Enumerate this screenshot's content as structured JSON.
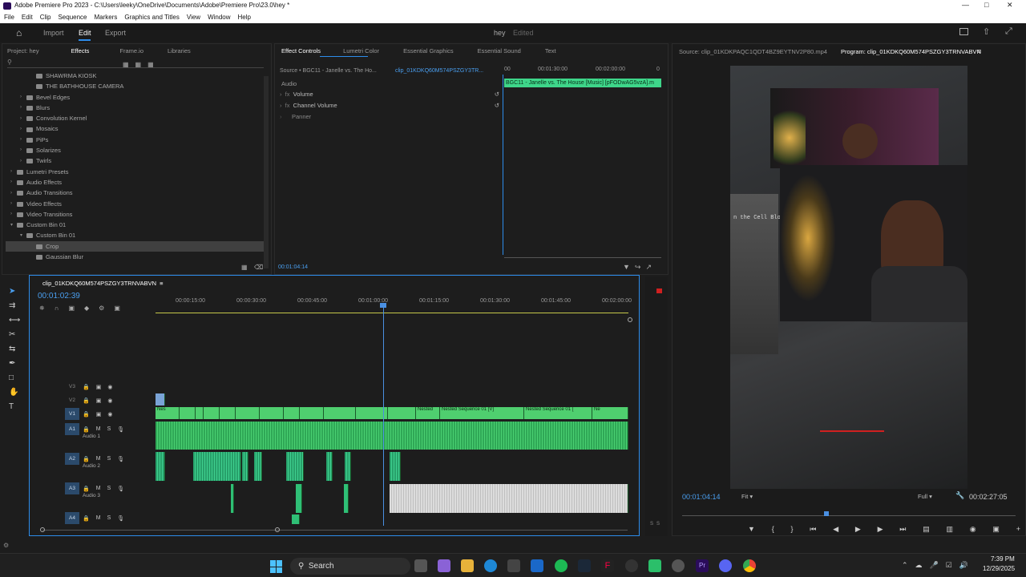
{
  "title": "Adobe Premiere Pro 2023 - C:\\Users\\leeky\\OneDrive\\Documents\\Adobe\\Premiere Pro\\23.0\\hey *",
  "menu": [
    "File",
    "Edit",
    "Clip",
    "Sequence",
    "Markers",
    "Graphics and Titles",
    "View",
    "Window",
    "Help"
  ],
  "workspace": {
    "import": "Import",
    "edit": "Edit",
    "export": "Export",
    "project_name": "hey",
    "status": "Edited"
  },
  "project_panel": {
    "tabs": [
      "Project: hey",
      "Effects",
      "Frame.io",
      "Libraries"
    ],
    "items": [
      {
        "label": "SHAWRMA KIOSK",
        "indent": 2
      },
      {
        "label": "THE BATHHOUSE CAMERA",
        "indent": 2
      },
      {
        "label": "Bevel Edges",
        "indent": 1
      },
      {
        "label": "Blurs",
        "indent": 1
      },
      {
        "label": "Convolution Kernel",
        "indent": 1
      },
      {
        "label": "Mosaics",
        "indent": 1
      },
      {
        "label": "PiPs",
        "indent": 1
      },
      {
        "label": "Solarizes",
        "indent": 1
      },
      {
        "label": "Twirls",
        "indent": 1
      },
      {
        "label": "Lumetri Presets",
        "indent": 0
      },
      {
        "label": "Audio Effects",
        "indent": 0
      },
      {
        "label": "Audio Transitions",
        "indent": 0
      },
      {
        "label": "Video Effects",
        "indent": 0
      },
      {
        "label": "Video Transitions",
        "indent": 0
      },
      {
        "label": "Custom Bin 01",
        "indent": 0
      },
      {
        "label": "Custom Bin 01",
        "indent": 1
      },
      {
        "label": "Crop",
        "indent": 2
      },
      {
        "label": "Gaussian Blur",
        "indent": 2
      }
    ]
  },
  "effect_controls": {
    "tabs": [
      "Effect Controls",
      "Lumetri Color",
      "Essential Graphics",
      "Essential Sound",
      "Text"
    ],
    "source_label": "Source • BGC11 - Janelle vs. The Ho...",
    "clip_label": "clip_01KDKQ60M574PSZGY3TR...",
    "section": "Audio",
    "effects": [
      "Volume",
      "Channel Volume",
      "Panner"
    ],
    "ruler": [
      "00",
      "00:01:30:00",
      "00:02:00:00",
      "0"
    ],
    "clip_bar": "BGC11 - Janelle vs. The House [Music] [pFODwAG5vzA].m",
    "timecode": "00:01:04:14"
  },
  "program_monitor": {
    "source_tab": "Source: clip_01KDKPAQC1QDT4BZ9EYTNV2P80.mp4",
    "program_tab": "Program: clip_01KDKQ60M574PSZGY3TRNVABVN",
    "overlay_text": "n the Cell Blo",
    "timecode": "00:01:04:14",
    "fit": "Fit",
    "resolution": "Full",
    "duration": "00:02:27:05"
  },
  "timeline": {
    "sequence_tab": "clip_01KDKQ60M574PSZGY3TRNVABVN",
    "timecode": "00:01:02:39",
    "ruler": [
      "00:00:15:00",
      "00:00:30:00",
      "00:00:45:00",
      "00:01:00:00",
      "00:01:15:00",
      "00:01:30:00",
      "00:01:45:00",
      "00:02:00:00"
    ],
    "tracks": [
      {
        "name": "V3",
        "label": ""
      },
      {
        "name": "V2",
        "label": ""
      },
      {
        "name": "V1",
        "label": ""
      },
      {
        "name": "A1",
        "label": "Audio 1"
      },
      {
        "name": "A2",
        "label": "Audio 2"
      },
      {
        "name": "A3",
        "label": "Audio 3"
      },
      {
        "name": "A4",
        "label": ""
      }
    ],
    "clip_labels": [
      "Nes",
      "Nested",
      "Nested Sequence 01 [V]",
      "Nested Sequence 01 [",
      "Ne"
    ],
    "meter_labels": [
      "S",
      "S"
    ]
  },
  "taskbar": {
    "search": "Search",
    "time": "7:39 PM",
    "date": "12/29/2025"
  },
  "colors": {
    "accent": "#2d8ceb",
    "clip_green": "#3fbf5f",
    "clip_audio": "#2fa856",
    "playhead": "#4a90e2"
  }
}
